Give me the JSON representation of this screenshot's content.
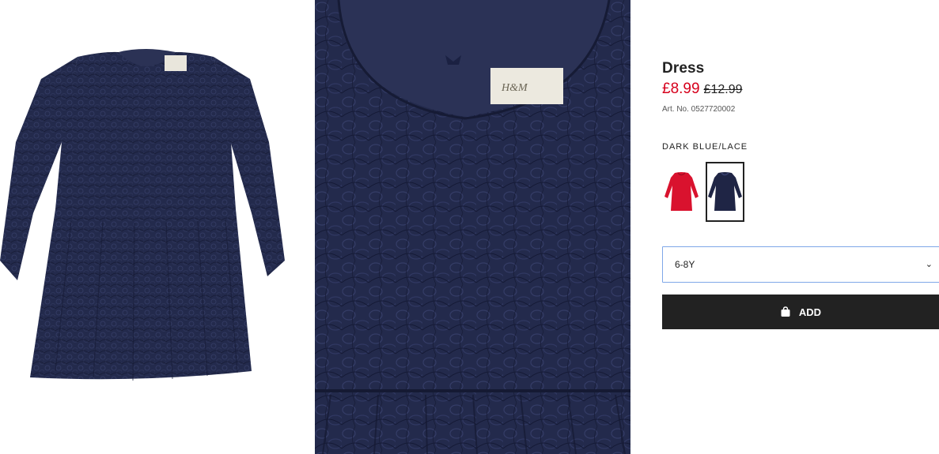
{
  "product": {
    "title": "Dress",
    "price_current": "£8.99",
    "price_original": "£12.99",
    "article_number": "Art. No. 0527720002",
    "color_name": "DARK BLUE/LACE"
  },
  "swatches": [
    {
      "name": "red-dress-swatch",
      "color": "#d9122e",
      "selected": false
    },
    {
      "name": "dark-blue-dress-swatch",
      "color": "#1f2545",
      "selected": true
    }
  ],
  "size_select": {
    "value": "6-8Y"
  },
  "add_button": {
    "label": "ADD",
    "icon": "shopping-bag-icon"
  },
  "colors": {
    "sale_price": "#d6001c",
    "dress_navy": "#1f2545",
    "button_bg": "#222222",
    "select_border": "#7fa7e8"
  },
  "images": {
    "main_label": "H&M"
  }
}
